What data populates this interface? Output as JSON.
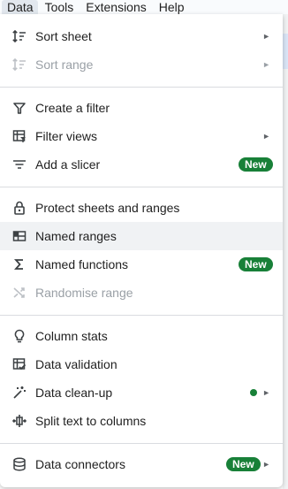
{
  "menubar": {
    "items": [
      "Data",
      "Tools",
      "Extensions",
      "Help"
    ]
  },
  "menu": {
    "sort_sheet": "Sort sheet",
    "sort_range": "Sort range",
    "create_filter": "Create a filter",
    "filter_views": "Filter views",
    "add_slicer": "Add a slicer",
    "protect": "Protect sheets and ranges",
    "named_ranges": "Named ranges",
    "named_functions": "Named functions",
    "randomise_range": "Randomise range",
    "column_stats": "Column stats",
    "data_validation": "Data validation",
    "data_cleanup": "Data clean-up",
    "split_text": "Split text to columns",
    "data_connectors": "Data connectors",
    "new_badge": "New",
    "submenu_arrow": "►"
  },
  "colors": {
    "badge_green": "#188038",
    "highlight": "#f0f2f4",
    "disabled_text": "#9aa0a6"
  },
  "icons": {
    "sort_sheet": "sort-icon",
    "sort_range": "sort-icon",
    "create_filter": "filter-funnel-icon",
    "filter_views": "filter-views-grid-icon",
    "add_slicer": "slicer-lines-icon",
    "protect": "lock-icon",
    "named_ranges": "table-grid-icon",
    "named_functions": "sigma-icon",
    "randomise_range": "shuffle-icon",
    "column_stats": "lightbulb-icon",
    "data_validation": "validation-checklist-icon",
    "data_cleanup": "magic-wand-icon",
    "split_text": "split-columns-icon",
    "data_connectors": "database-icon"
  }
}
